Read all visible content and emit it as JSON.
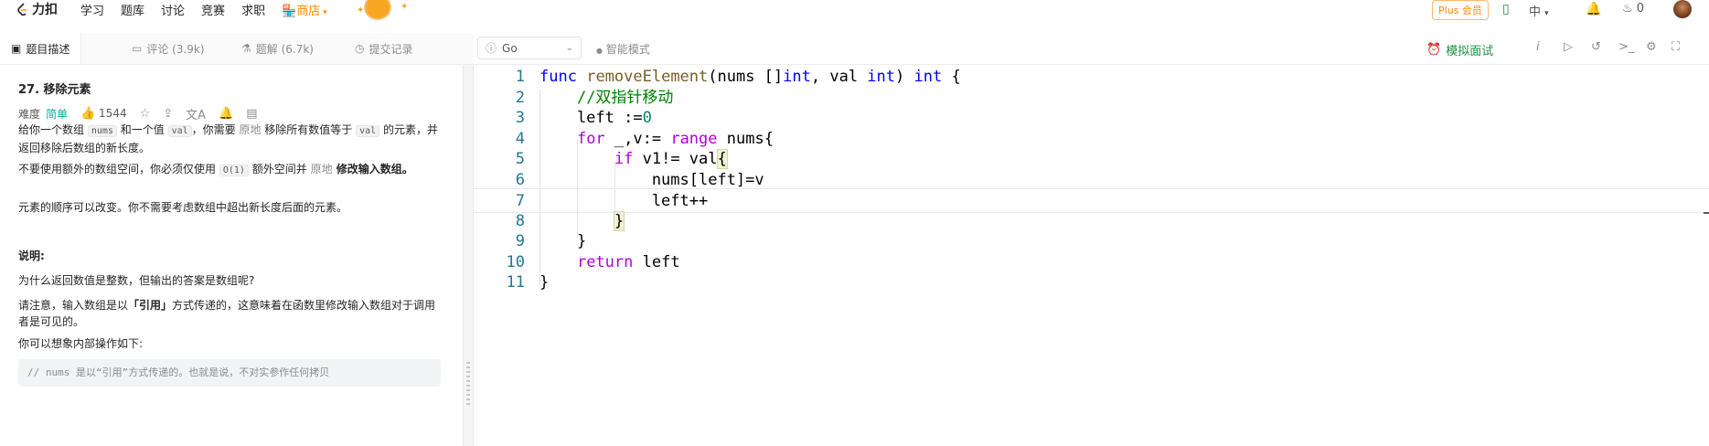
{
  "topbar": {
    "logo": "力扣",
    "nav": [
      "学习",
      "题库",
      "讨论",
      "竞赛",
      "求职"
    ],
    "store": "商店",
    "plus": "Plus 会员",
    "lang": "中",
    "notifications": "0"
  },
  "tabs": [
    {
      "label": "题目描述",
      "icon": "description-icon"
    },
    {
      "label": "评论 (3.9k)",
      "icon": "comment-icon"
    },
    {
      "label": "题解 (6.7k)",
      "icon": "flask-icon"
    },
    {
      "label": "提交记录",
      "icon": "history-icon"
    }
  ],
  "problem": {
    "title": "27. 移除元素",
    "difficulty_label": "难度",
    "difficulty": "简单",
    "likes": "1544",
    "p1": {
      "a": "给你一个数组 ",
      "c1": "nums",
      "b": " 和一个值 ",
      "c2": "val",
      "c": "，你需要 ",
      "g": "原地",
      "d": " 移除所有数值等于 ",
      "c3": "val",
      "e": " 的元素，并返回移除后数组的新长度。"
    },
    "p2": {
      "a": "不要使用额外的数组空间，你必须仅使用 ",
      "c": "O(1)",
      "b": " 额外空间并 ",
      "g": "原地",
      "bold": " 修改输入数组",
      "end": "。"
    },
    "p3": "元素的顺序可以改变。你不需要考虑数组中超出新长度后面的元素。",
    "explain_title": "说明:",
    "p4": "为什么返回数值是整数，但输出的答案是数组呢?",
    "p5": {
      "a": "请注意，输入数组是以",
      "bold": "「引用」",
      "b": "方式传递的，这意味着在函数里修改输入数组对于调用者是可见的。"
    },
    "p6": "你可以想象内部操作如下:",
    "code_snippet": "// nums 是以“引用”方式传递的。也就是说，不对实参作任何拷贝"
  },
  "editor": {
    "language": "Go",
    "smart_mode": "智能模式",
    "mock_interview": "模拟面试",
    "lines": [
      "1",
      "2",
      "3",
      "4",
      "5",
      "6",
      "7",
      "8",
      "9",
      "10",
      "11"
    ]
  },
  "colors": {
    "accent": "#00af9b",
    "store": "#ff8a00",
    "keyword": "#0000ff",
    "control": "#af00db",
    "comment": "#008000",
    "line_number": "#237893"
  }
}
